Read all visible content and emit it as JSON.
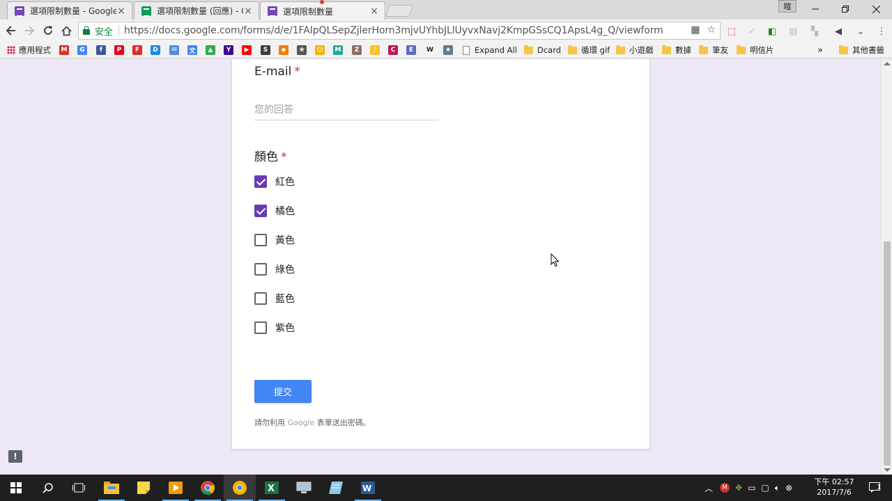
{
  "browser": {
    "tabs": [
      {
        "title": "選項限制數量 - Google 表單",
        "favicon": "forms-icon",
        "active": false
      },
      {
        "title": "選項限制數量 (回應) - Google 試算表",
        "favicon": "sheets-icon",
        "active": false
      },
      {
        "title": "選項限制數量",
        "favicon": "forms-icon",
        "active": true
      }
    ],
    "profile_label": "暄",
    "security_label": "安全",
    "url": "https://docs.google.com/forms/d/e/1FAIpQLSepZjlerHorn3mjvUYhbJLlUyvxNavj2KmpGSsCQ1ApsL4g_Q/viewform",
    "bookmarks": [
      {
        "label": "應用程式",
        "icon": "apps-icon"
      },
      {
        "label": "Expand All",
        "icon": "page-icon"
      },
      {
        "label": "Dcard",
        "icon": "folder-icon"
      },
      {
        "label": "循環 gif",
        "icon": "folder-icon"
      },
      {
        "label": "小遊戲",
        "icon": "folder-icon"
      },
      {
        "label": "數據",
        "icon": "folder-icon"
      },
      {
        "label": "筆友",
        "icon": "folder-icon"
      },
      {
        "label": "明信片",
        "icon": "folder-icon"
      },
      {
        "label": "»",
        "icon": "more-icon"
      },
      {
        "label": "其他書籤",
        "icon": "folder-icon"
      }
    ],
    "bookmark_site_icons": [
      {
        "glyph": "M",
        "color": "#d93025"
      },
      {
        "glyph": "G",
        "color": "#4285f4"
      },
      {
        "glyph": "f",
        "color": "#3b5998"
      },
      {
        "glyph": "P",
        "color": "#e60023"
      },
      {
        "glyph": "F",
        "color": "#e12828"
      },
      {
        "glyph": "D",
        "color": "#1e88e5"
      },
      {
        "glyph": "✉",
        "color": "#4f8ee0"
      },
      {
        "glyph": "文",
        "color": "#4285f4"
      },
      {
        "glyph": "▲",
        "color": "#34a853"
      },
      {
        "glyph": "Y",
        "color": "#410093"
      },
      {
        "glyph": "▶",
        "color": "#ff0000"
      },
      {
        "glyph": "S",
        "color": "#3c3c3c"
      },
      {
        "glyph": "◆",
        "color": "#f57c00"
      },
      {
        "glyph": "❀",
        "color": "#555555"
      },
      {
        "glyph": "☺",
        "color": "#f4b400"
      },
      {
        "glyph": "M",
        "color": "#26a69a"
      },
      {
        "glyph": "Z",
        "color": "#8d6e63"
      },
      {
        "glyph": "♪",
        "color": "#fbc02d"
      },
      {
        "glyph": "C",
        "color": "#c2185b"
      },
      {
        "glyph": "E",
        "color": "#5c6bc0"
      },
      {
        "glyph": "W",
        "color": "#ffffff"
      },
      {
        "glyph": "★",
        "color": "#607d8b"
      }
    ]
  },
  "form": {
    "email_question": {
      "title": "E-mail",
      "required_mark": "*",
      "placeholder": "您的回答"
    },
    "color_question": {
      "title": "顏色",
      "required_mark": "*",
      "options": [
        {
          "label": "紅色",
          "checked": true
        },
        {
          "label": "橘色",
          "checked": true
        },
        {
          "label": "黃色",
          "checked": false
        },
        {
          "label": "綠色",
          "checked": false
        },
        {
          "label": "藍色",
          "checked": false
        },
        {
          "label": "紫色",
          "checked": false
        }
      ]
    },
    "submit_label": "提交",
    "footer_prefix": "請勿利用 ",
    "footer_brand": "Google",
    "footer_suffix": " 表單送出密碼。",
    "accent_color": "#673ab7"
  },
  "taskbar": {
    "apps": [
      "windows-start-icon",
      "search-icon",
      "task-view-icon",
      "file-explorer-icon",
      "sticky-notes-icon",
      "media-player-icon",
      "chrome-icon",
      "chrome-canary-icon",
      "excel-icon",
      "pc-icon",
      "notes-icon",
      "word-icon"
    ],
    "clock_time": "下午 02:57",
    "clock_date": "2017/7/6",
    "notification_count": "1"
  }
}
